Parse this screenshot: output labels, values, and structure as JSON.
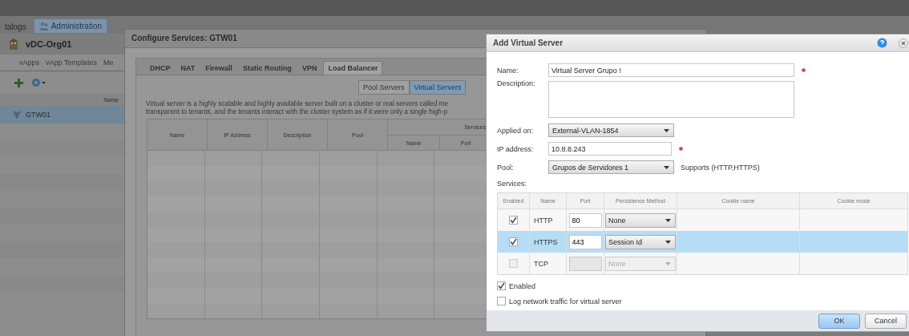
{
  "top_tabs": [
    {
      "label": "talogs",
      "selected": false
    },
    {
      "label": "Administration",
      "selected": true
    }
  ],
  "sidebar": {
    "title": "vDC-Org01",
    "tabs": [
      {
        "label": "vApps"
      },
      {
        "label": "vApp Templates"
      },
      {
        "label": "Me"
      }
    ],
    "column": "Name",
    "items": [
      {
        "label": "GTW01",
        "selected": true
      }
    ]
  },
  "configure_dialog": {
    "title": "Configure Services: GTW01",
    "tabs": [
      {
        "label": "DHCP",
        "selected": false
      },
      {
        "label": "NAT",
        "selected": false
      },
      {
        "label": "Firewall",
        "selected": false
      },
      {
        "label": "Static Routing",
        "selected": false
      },
      {
        "label": "VPN",
        "selected": false
      },
      {
        "label": "Load Balancer",
        "selected": true
      }
    ],
    "views": [
      {
        "label": "Pool Servers",
        "selected": false
      },
      {
        "label": "Virtual Servers",
        "selected": true
      }
    ],
    "description": [
      "Virtual server is a highly scalable and highly available server built on a cluster or real servers called me",
      "transparent to tenants, and the tenants interact with the cluster system as if it were only a single high-p"
    ],
    "table": {
      "columns": [
        "Name",
        "IP Address",
        "Description",
        "Pool"
      ],
      "group": "Services",
      "group_columns": [
        "Name",
        "Port"
      ]
    }
  },
  "add_dialog": {
    "title": "Add Virtual Server",
    "fields": [
      {
        "kind": "text",
        "label": "Name:",
        "value": "Virtual Server Grupo !",
        "required": true
      },
      {
        "kind": "textarea",
        "label": "Description:"
      },
      {
        "kind": "select",
        "label": "Applied on:",
        "value": "External-VLAN-1854"
      },
      {
        "kind": "text",
        "label": "IP address:",
        "value": "10.8.8.243",
        "required": true
      },
      {
        "kind": "select",
        "label": "Pool:",
        "value": "Grupos de Servidores 1",
        "note": "Supports (HTTP,HTTPS)"
      }
    ],
    "services_label": "Services:",
    "services": {
      "columns": [
        "Enabled",
        "Name",
        "Port",
        "Persistence Method",
        "Cookie name",
        "Cookie mode"
      ],
      "rows": [
        {
          "enabled": true,
          "name": "HTTP",
          "port": "80",
          "persistence": "None",
          "selected": false,
          "disabled": false
        },
        {
          "enabled": true,
          "name": "HTTPS",
          "port": "443",
          "persistence": "Session Id",
          "selected": true,
          "disabled": false
        },
        {
          "enabled": false,
          "name": "TCP",
          "persistence": "None",
          "selected": false,
          "disabled": true
        }
      ]
    },
    "options": [
      {
        "label": "Enabled",
        "checked": true
      },
      {
        "label": "Log network traffic for virtual server",
        "checked": false
      }
    ],
    "buttons": [
      {
        "label": "OK",
        "kind": "primary"
      },
      {
        "label": "Cancel",
        "kind": "secondary"
      }
    ]
  }
}
